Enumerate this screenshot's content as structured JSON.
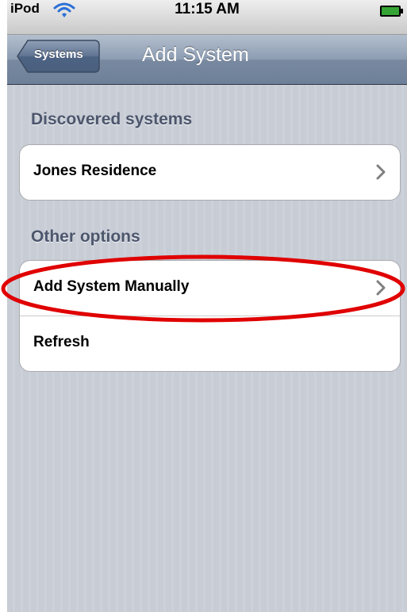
{
  "status_bar": {
    "carrier": "iPod",
    "time": "11:15 AM",
    "wifi_icon": "wifi-icon",
    "battery_icon": "battery-icon"
  },
  "nav_bar": {
    "back_label": "Systems",
    "title": "Add System"
  },
  "sections": [
    {
      "header": "Discovered systems",
      "items": [
        {
          "label": "Jones Residence",
          "accessory": "chevron-right-icon"
        }
      ]
    },
    {
      "header": "Other options",
      "items": [
        {
          "label": "Add System Manually",
          "accessory": "chevron-right-icon"
        },
        {
          "label": "Refresh",
          "accessory": ""
        }
      ]
    }
  ],
  "colors": {
    "annotation_ellipse": "#e00000",
    "nav_bar": "#8293aa",
    "table_background": "#c7ccd5",
    "section_header": "#4c566c"
  }
}
